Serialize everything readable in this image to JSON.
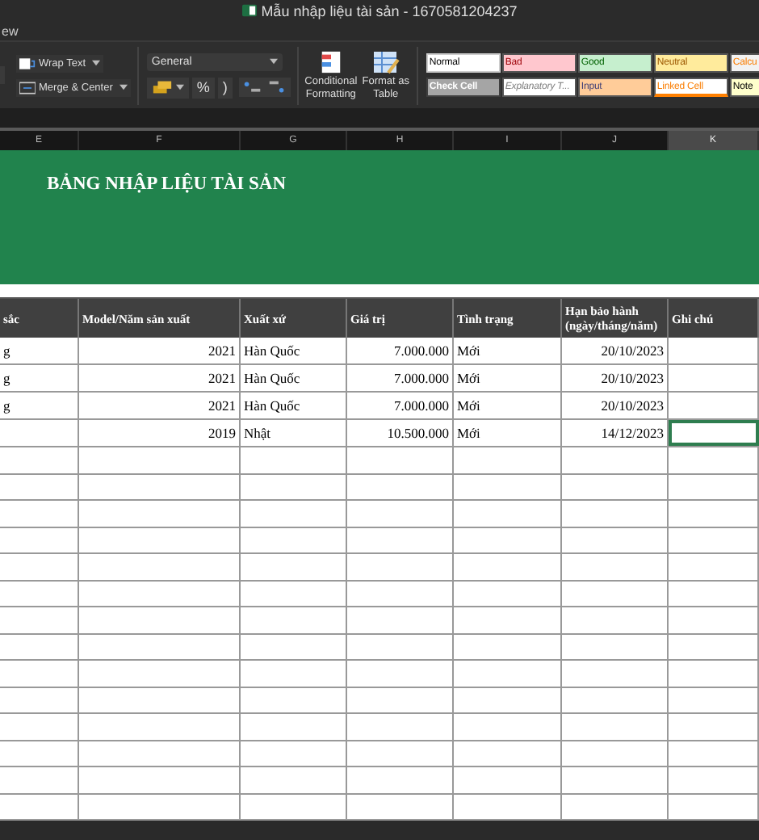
{
  "window": {
    "title": "Mẫu nhập liệu tài sản - 1670581204237"
  },
  "menu": [
    "ew"
  ],
  "ribbon": {
    "wrap_text": "Wrap Text",
    "merge_center": "Merge & Center",
    "number_format": "General",
    "percent": "%",
    "comma": ")",
    "conditional_formatting": "Conditional Formatting",
    "format_as_table": "Format as Table",
    "styles": [
      {
        "label": "Normal",
        "kind": "normal"
      },
      {
        "label": "Bad",
        "kind": "bad"
      },
      {
        "label": "Good",
        "kind": "good"
      },
      {
        "label": "Neutral",
        "kind": "neutral"
      },
      {
        "label": "Calcu",
        "kind": "calculation"
      },
      {
        "label": "Check Cell",
        "kind": "check"
      },
      {
        "label": "Explanatory T...",
        "kind": "explanatory"
      },
      {
        "label": "Input",
        "kind": "input"
      },
      {
        "label": "Linked Cell",
        "kind": "linked"
      },
      {
        "label": "Note",
        "kind": "note"
      }
    ]
  },
  "column_headers": [
    {
      "label": "E",
      "selected": false
    },
    {
      "label": "F",
      "selected": false
    },
    {
      "label": "G",
      "selected": false
    },
    {
      "label": "H",
      "selected": false
    },
    {
      "label": "I",
      "selected": false
    },
    {
      "label": "J",
      "selected": false
    },
    {
      "label": "K",
      "selected": true
    }
  ],
  "sheet_title": "BẢNG NHẬP LIỆU TÀI SẢN",
  "table": {
    "columns": [
      "sắc",
      "Model/Năm sản xuất",
      "Xuất xứ",
      "Giá trị",
      "Tình trạng",
      "Hạn bảo hành (ngày/tháng/năm)",
      "Ghi chú"
    ],
    "rows": [
      {
        "cells": [
          "g",
          "2021",
          "Hàn Quốc",
          "7.000.000",
          "Mới",
          "20/10/2023"
        ],
        "selected": false
      },
      {
        "cells": [
          "g",
          "2021",
          "Hàn Quốc",
          "7.000.000",
          "Mới",
          "20/10/2023"
        ],
        "selected": false
      },
      {
        "cells": [
          "g",
          "2021",
          "Hàn Quốc",
          "7.000.000",
          "Mới",
          "20/10/2023"
        ],
        "selected": false
      },
      {
        "cells": [
          "",
          "2019",
          "Nhật",
          "10.500.000",
          "Mới",
          "14/12/2023"
        ],
        "selected": true
      }
    ]
  }
}
